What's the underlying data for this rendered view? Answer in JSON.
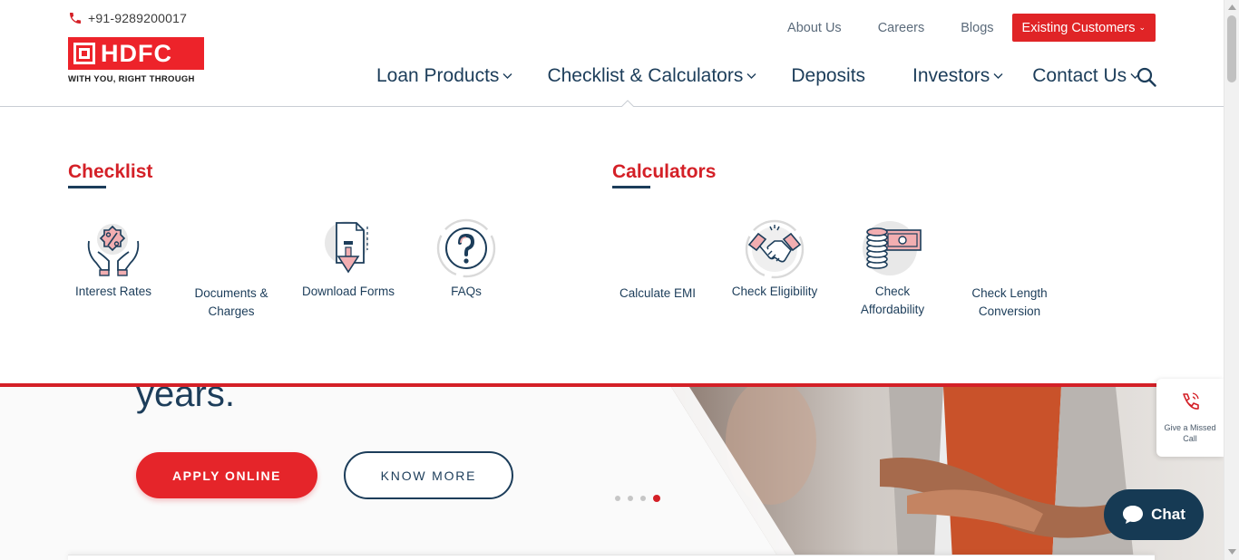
{
  "header": {
    "phone": "+91-9289200017",
    "logo": {
      "brand": "HDFC",
      "tagline": "WITH YOU, RIGHT THROUGH"
    },
    "top_links": [
      "About Us",
      "Careers",
      "Blogs"
    ],
    "existing_customers": "Existing Customers",
    "nav": [
      {
        "label": "Loan Products",
        "dropdown": true
      },
      {
        "label": "Checklist & Calculators",
        "dropdown": true
      },
      {
        "label": "Deposits",
        "dropdown": false
      },
      {
        "label": "Investors",
        "dropdown": true
      },
      {
        "label": "Contact Us",
        "dropdown": true
      }
    ]
  },
  "mega_menu": {
    "checklist": {
      "title": "Checklist",
      "items": [
        {
          "label": "Interest Rates",
          "icon": "hands-percent-icon"
        },
        {
          "label": "Documents & Charges",
          "icon": ""
        },
        {
          "label": "Download Forms",
          "icon": "download-document-icon"
        },
        {
          "label": "FAQs",
          "icon": "question-mark-icon"
        }
      ]
    },
    "calculators": {
      "title": "Calculators",
      "items": [
        {
          "label": "Calculate EMI",
          "icon": ""
        },
        {
          "label": "Check Eligibility",
          "icon": "handshake-icon"
        },
        {
          "label": "Check Affordability",
          "icon": "coins-banknote-icon"
        },
        {
          "label": "Check Length Conversion",
          "icon": ""
        }
      ]
    }
  },
  "hero": {
    "title_fragment": "years.",
    "apply_label": "APPLY ONLINE",
    "know_label": "KNOW MORE",
    "slides_total": 4,
    "slide_active": 4
  },
  "floating": {
    "missed_call": "Give a Missed Call",
    "chat": "Chat"
  },
  "colors": {
    "brand_red": "#ed232a",
    "navy": "#1c3d5a",
    "chat_bg": "#163a54"
  }
}
